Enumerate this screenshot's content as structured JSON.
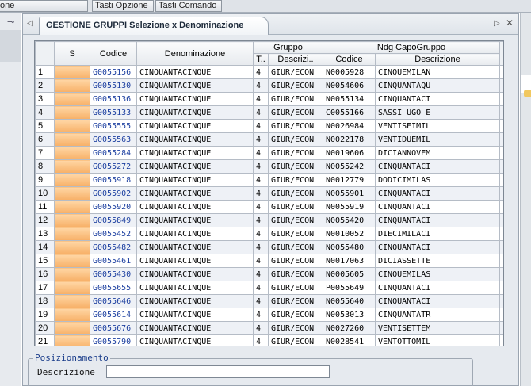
{
  "topbar": {
    "items": [
      "one",
      "Tasti Opzione",
      "Tasti Comando"
    ]
  },
  "window": {
    "title": "GESTIONE GRUPPI",
    "subtitle": "Selezione x Denominazione"
  },
  "grid": {
    "headers": {
      "s": "S",
      "codice": "Codice",
      "denominazione": "Denominazione",
      "gruppo": "Gruppo",
      "gruppo_t": "T..",
      "gruppo_descr": "Descrizi..",
      "ndg": "Ndg CapoGruppo",
      "ndg_codice": "Codice",
      "ndg_descr": "Descrizione"
    },
    "rows": [
      {
        "n": "1",
        "codice": "G0055156",
        "den": "CINQUANTACINQUE",
        "t": "4",
        "descr": "GIUR/ECON",
        "ndg": "N0005928",
        "ndg_descr": "CINQUEMILAN"
      },
      {
        "n": "2",
        "codice": "G0055130",
        "den": "CINQUANTACINQUE",
        "t": "4",
        "descr": "GIUR/ECON",
        "ndg": "N0054606",
        "ndg_descr": "CINQUANTAQU"
      },
      {
        "n": "3",
        "codice": "G0055136",
        "den": "CINQUANTACINQUE",
        "t": "4",
        "descr": "GIUR/ECON",
        "ndg": "N0055134",
        "ndg_descr": "CINQUANTACI"
      },
      {
        "n": "4",
        "codice": "G0055133",
        "den": "CINQUANTACINQUE",
        "t": "4",
        "descr": "GIUR/ECON",
        "ndg": "C0055166",
        "ndg_descr": "SASSI UGO E"
      },
      {
        "n": "5",
        "codice": "G0055555",
        "den": "CINQUANTACINQUE",
        "t": "4",
        "descr": "GIUR/ECON",
        "ndg": "N0026984",
        "ndg_descr": "VENTISEIMIL"
      },
      {
        "n": "6",
        "codice": "G0055563",
        "den": "CINQUANTACINQUE",
        "t": "4",
        "descr": "GIUR/ECON",
        "ndg": "N0022178",
        "ndg_descr": "VENTIDUEMIL"
      },
      {
        "n": "7",
        "codice": "G0055284",
        "den": "CINQUANTACINQUE",
        "t": "4",
        "descr": "GIUR/ECON",
        "ndg": "N0019606",
        "ndg_descr": "DICIANNOVEM"
      },
      {
        "n": "8",
        "codice": "G0055272",
        "den": "CINQUANTACINQUE",
        "t": "4",
        "descr": "GIUR/ECON",
        "ndg": "N0055242",
        "ndg_descr": "CINQUANTACI"
      },
      {
        "n": "9",
        "codice": "G0055918",
        "den": "CINQUANTACINQUE",
        "t": "4",
        "descr": "GIUR/ECON",
        "ndg": "N0012779",
        "ndg_descr": "DODICIMILAS"
      },
      {
        "n": "10",
        "codice": "G0055902",
        "den": "CINQUANTACINQUE",
        "t": "4",
        "descr": "GIUR/ECON",
        "ndg": "N0055901",
        "ndg_descr": "CINQUANTACI"
      },
      {
        "n": "11",
        "codice": "G0055920",
        "den": "CINQUANTACINQUE",
        "t": "4",
        "descr": "GIUR/ECON",
        "ndg": "N0055919",
        "ndg_descr": "CINQUANTACI"
      },
      {
        "n": "12",
        "codice": "G0055849",
        "den": "CINQUANTACINQUE",
        "t": "4",
        "descr": "GIUR/ECON",
        "ndg": "N0055420",
        "ndg_descr": "CINQUANTACI"
      },
      {
        "n": "13",
        "codice": "G0055452",
        "den": "CINQUANTACINQUE",
        "t": "4",
        "descr": "GIUR/ECON",
        "ndg": "N0010052",
        "ndg_descr": "DIECIMILACI"
      },
      {
        "n": "14",
        "codice": "G0055482",
        "den": "CINQUANTACINQUE",
        "t": "4",
        "descr": "GIUR/ECON",
        "ndg": "N0055480",
        "ndg_descr": "CINQUANTACI"
      },
      {
        "n": "15",
        "codice": "G0055461",
        "den": "CINQUANTACINQUE",
        "t": "4",
        "descr": "GIUR/ECON",
        "ndg": "N0017063",
        "ndg_descr": "DICIASSETTE"
      },
      {
        "n": "16",
        "codice": "G0055430",
        "den": "CINQUANTACINQUE",
        "t": "4",
        "descr": "GIUR/ECON",
        "ndg": "N0005605",
        "ndg_descr": "CINQUEMILAS"
      },
      {
        "n": "17",
        "codice": "G0055655",
        "den": "CINQUANTACINQUE",
        "t": "4",
        "descr": "GIUR/ECON",
        "ndg": "P0055649",
        "ndg_descr": "CINQUANTACI"
      },
      {
        "n": "18",
        "codice": "G0055646",
        "den": "CINQUANTACINQUE",
        "t": "4",
        "descr": "GIUR/ECON",
        "ndg": "N0055640",
        "ndg_descr": "CINQUANTACI"
      },
      {
        "n": "19",
        "codice": "G0055614",
        "den": "CINQUANTACINQUE",
        "t": "4",
        "descr": "GIUR/ECON",
        "ndg": "N0053013",
        "ndg_descr": "CINQUANTATR"
      },
      {
        "n": "20",
        "codice": "G0055676",
        "den": "CINQUANTACINQUE",
        "t": "4",
        "descr": "GIUR/ECON",
        "ndg": "N0027260",
        "ndg_descr": "VENTISETTEM"
      },
      {
        "n": "21",
        "codice": "G0055790",
        "den": "CINQUANTACINQUE",
        "t": "4",
        "descr": "GIUR/ECON",
        "ndg": "N0028541",
        "ndg_descr": "VENTOTTOMIL"
      }
    ]
  },
  "positioning": {
    "title": "Posizionamento",
    "label": "Descrizione",
    "value": ""
  },
  "colors": {
    "s_column": "#f7b067",
    "code_text": "#1c3fa0",
    "title_text": "#1d3f8c"
  },
  "icons": [
    "pin-icon",
    "tab-scroll-left-icon",
    "tab-scroll-right-icon",
    "close-icon"
  ]
}
